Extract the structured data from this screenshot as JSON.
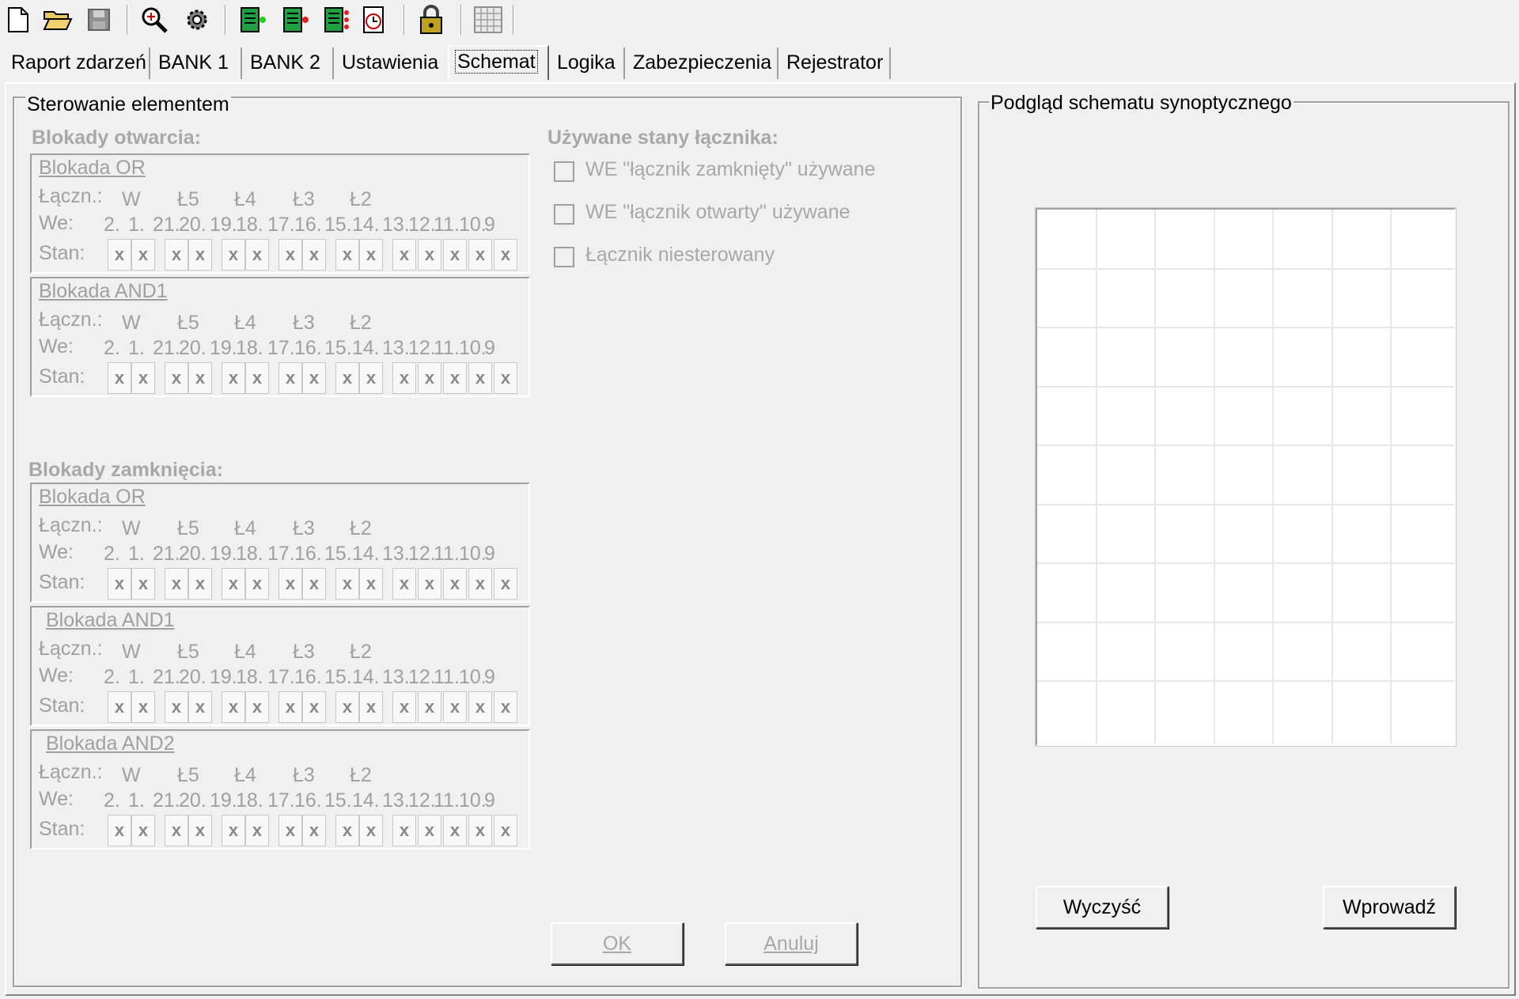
{
  "toolbar": {
    "buttons": [
      {
        "name": "new-file-icon",
        "glyph": "🗋"
      },
      {
        "name": "open-folder-icon",
        "glyph": "📂"
      },
      {
        "name": "save-icon",
        "glyph": "💾"
      },
      {
        "name": "search-zoom-icon",
        "glyph": "🔍"
      },
      {
        "name": "settings-gear-icon",
        "glyph": "⚙"
      },
      {
        "name": "device-green-icon",
        "glyph": "▦"
      },
      {
        "name": "device-red-icon",
        "glyph": "▦"
      },
      {
        "name": "device-red-multi-icon",
        "glyph": "▦"
      },
      {
        "name": "clock-document-icon",
        "glyph": "◷"
      },
      {
        "name": "lock-icon",
        "glyph": "🔒"
      },
      {
        "name": "grid-icon",
        "glyph": "▦"
      }
    ]
  },
  "tabs": [
    "Raport zdarzeń",
    "BANK 1",
    "BANK 2",
    "Ustawienia",
    "Schemat",
    "Logika",
    "Zabezpieczenia",
    "Rejestrator"
  ],
  "active_tab": "Schemat",
  "left_panel": {
    "title": "Sterowanie elementem",
    "open_locks_heading": "Blokady otwarcia:",
    "close_locks_heading": "Blokady zamknięcia:",
    "used_states_heading": "Używane stany łącznika:",
    "checkboxes": [
      {
        "label": "WE \"łącznik zamknięty\" używane",
        "checked": false
      },
      {
        "label": "WE \"łącznik otwarty\" używane",
        "checked": false
      },
      {
        "label": "Łącznik niesterowany",
        "checked": false
      }
    ],
    "row_labels": {
      "lacz": "Łączn.:",
      "we": "We:",
      "stan": "Stan:"
    },
    "lacz_values": [
      "W",
      "Ł5",
      "Ł4",
      "Ł3",
      "Ł2"
    ],
    "we_values": [
      "2.",
      "1.",
      "21.",
      "20.",
      "19.",
      "18.",
      "17.",
      "16.",
      "15.",
      "14.",
      "13.",
      "12.",
      "11.",
      "10.",
      "9"
    ],
    "stan_value": "x",
    "open_blocks": [
      "Blokada OR",
      "Blokada AND1"
    ],
    "close_blocks": [
      "Blokada OR",
      "Blokada AND1",
      "Blokada AND2"
    ],
    "ok_label": "OK",
    "cancel_label": "Anuluj"
  },
  "right_panel": {
    "title": "Podgląd schematu synoptycznego",
    "clear_label": "Wyczyść",
    "enter_label": "Wprowadź"
  }
}
